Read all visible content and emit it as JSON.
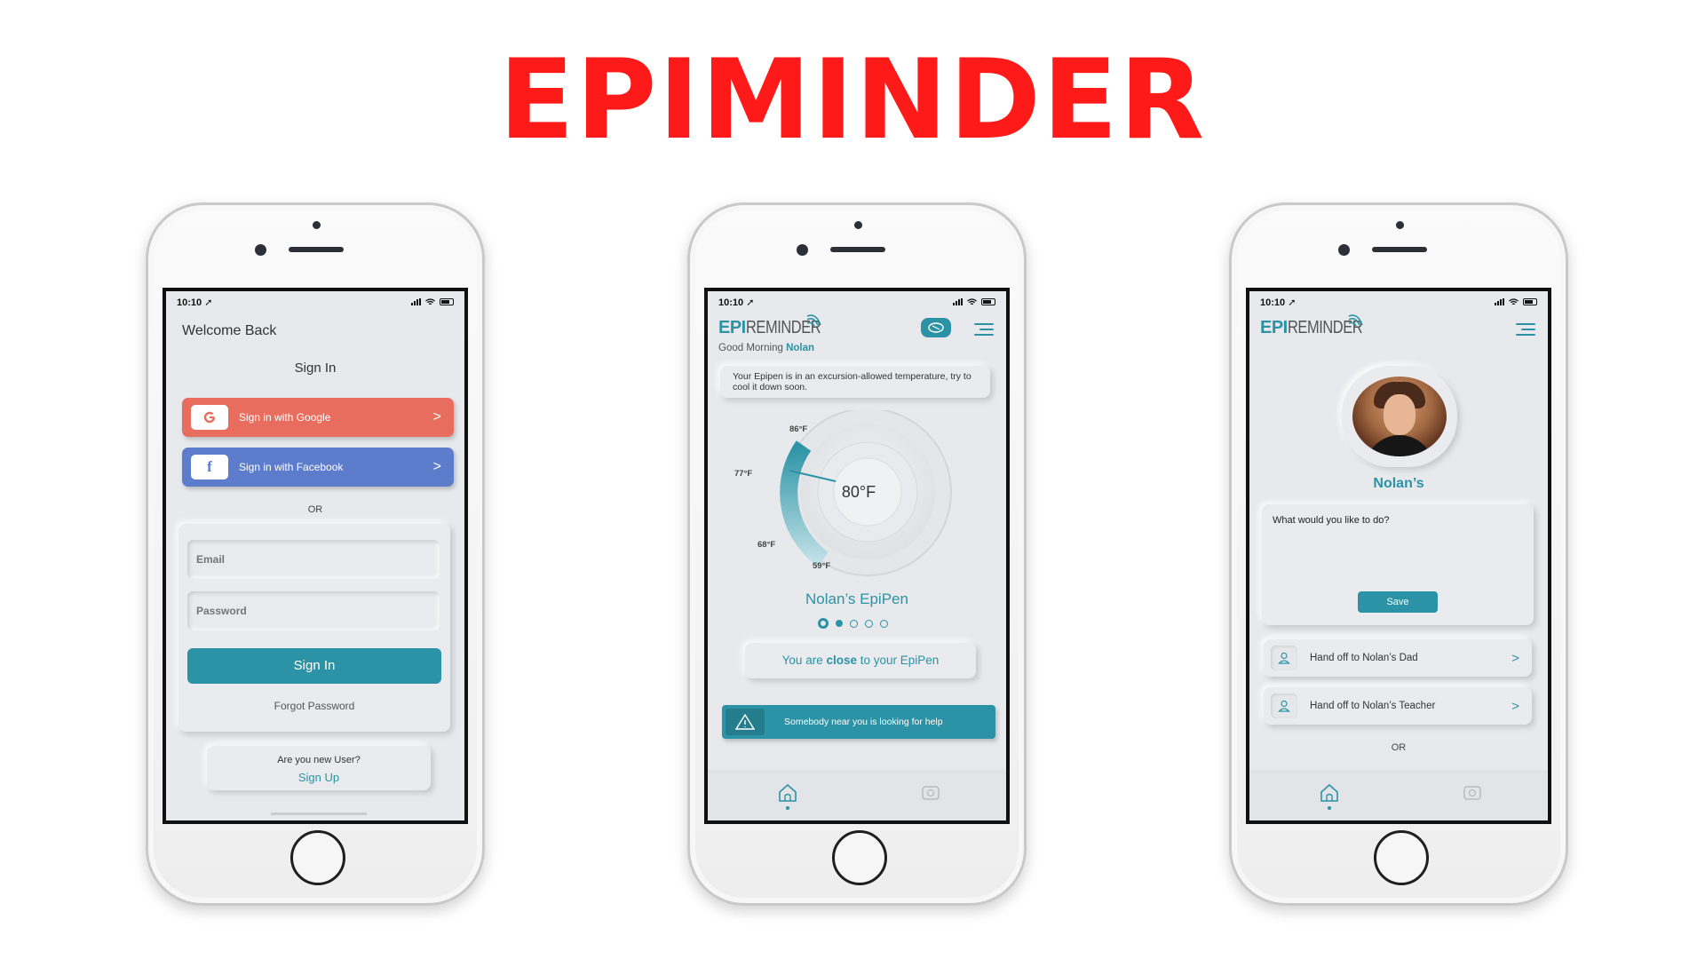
{
  "headline": "EPIMINDER",
  "status_bar": {
    "time": "10:10 ➚"
  },
  "login_screen": {
    "welcome": "Welcome Back",
    "title": "Sign In",
    "google": {
      "icon": "google-icon",
      "label": "Sign in with Google",
      "chevron": ">"
    },
    "facebook": {
      "icon": "facebook-icon",
      "label": "Sign in with Facebook",
      "chevron": ">"
    },
    "or": "OR",
    "email_label": "Email",
    "password_label": "Password",
    "sign_in_button": "Sign In",
    "forgot_password": "Forgot Password",
    "new_user_question": "Are you new User?",
    "sign_up": "Sign Up"
  },
  "logo": {
    "epi": "EPI",
    "reminder": "REMINDER"
  },
  "dashboard_screen": {
    "greeting_prefix": "Good Morning",
    "user_name": "Nolan",
    "notice": "Your Epipen is in an excursion-allowed temperature, try to cool it down soon.",
    "gauge": {
      "current": "80",
      "unit": "°F",
      "labels": [
        "86°F",
        "77°F",
        "68°F",
        "59°F"
      ]
    },
    "device_title": "Nolan’s EpiPen",
    "carousel_pages": 5,
    "carousel_active": 1,
    "proximity": {
      "prefix": "You are",
      "emphasis": "close",
      "suffix": "to your EpiPen"
    },
    "alert": "Somebody near you is looking for help"
  },
  "profile_screen": {
    "name": "Nolan’s",
    "prompt": "What would you like to do?",
    "save": "Save",
    "handoffs": [
      "Hand off to Nolan’s Dad",
      "Hand off to Nolan’s Teacher"
    ],
    "or": "OR"
  },
  "colors": {
    "accent": "#2b93a5",
    "headline": "#ff1a1a",
    "google": "#e86d5f",
    "facebook": "#5d7ccb"
  }
}
